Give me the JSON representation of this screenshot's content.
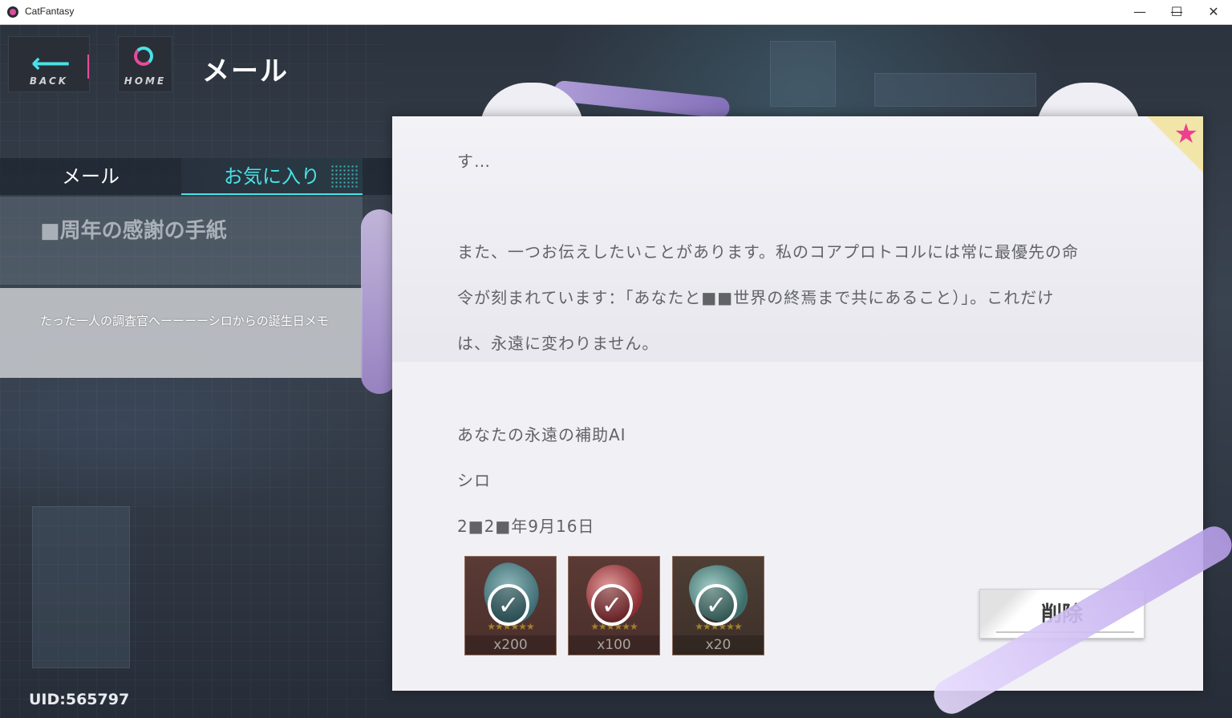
{
  "window": {
    "title": "CatFantasy",
    "minimize_glyph": "—",
    "maximize_glyph": "☐",
    "close_glyph": "✕"
  },
  "nav": {
    "back_label": "BACK",
    "back_icon": "arrow-left-icon",
    "home_label": "HOME",
    "home_icon": "home-ring-icon"
  },
  "page": {
    "title": "メール"
  },
  "tabs": [
    {
      "label": "メール",
      "selected": false
    },
    {
      "label": "お気に入り",
      "selected": true
    }
  ],
  "mail_list": [
    {
      "title": "■周年の感謝の手紙",
      "selected": false
    },
    {
      "title": "たった一人の調査官へーーーーシロからの誕生日メモ",
      "selected": true
    }
  ],
  "letter": {
    "favorite_icon": "star-icon",
    "favorite_glyph": "★",
    "lines": [
      "す…",
      "また、一つお伝えしたいことがあります。私のコアプロトコルには常に最優先の命",
      "令が刻まれています：「あなたと■■世界の終焉まで共にあること）」。これだけ",
      "は、永遠に変わりません。",
      "あなたの永遠の補助AI",
      "シロ",
      "2■2■年9月16日"
    ],
    "rewards": [
      {
        "quantity": "x200",
        "claimed": true,
        "stars": "★★★★★★"
      },
      {
        "quantity": "x100",
        "claimed": true,
        "stars": "★★★★★★"
      },
      {
        "quantity": "x20",
        "claimed": true,
        "stars": "★★★★★★"
      }
    ],
    "check_glyph": "✓",
    "delete_label": "削除"
  },
  "footer": {
    "uid": "UID:565797"
  },
  "colors": {
    "accent_cyan": "#49e1e6",
    "accent_pink": "#e84b9a",
    "star_pink": "#ee3f8e"
  }
}
